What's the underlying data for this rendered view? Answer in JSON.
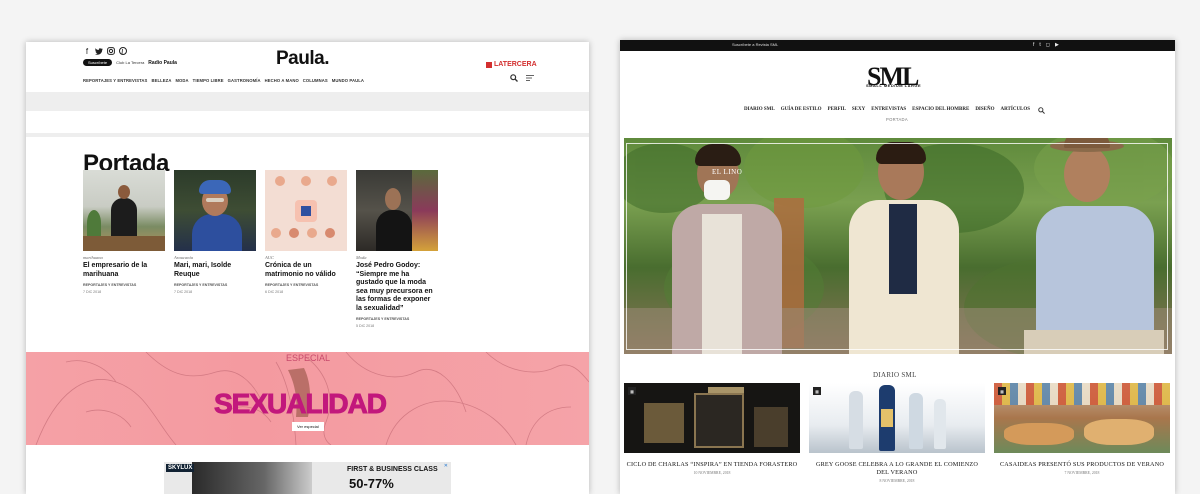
{
  "paula": {
    "logo": "Paula.",
    "tercera": "LATERCERA",
    "social_icons": [
      "facebook-icon",
      "twitter-icon",
      "instagram-icon",
      "pinterest-icon"
    ],
    "radio": {
      "pill": "Suscríbete",
      "club": "Club La Tercera",
      "radio_label": "Radio Paula"
    },
    "nav": [
      "REPORTAJES Y ENTREVISTAS",
      "BELLEZA",
      "MODA",
      "TIEMPO LIBRE",
      "GASTRONOMÍA",
      "HECHO A MANO",
      "COLUMNAS",
      "MUNDO PAULA"
    ],
    "section_title": "Portada",
    "cards": [
      {
        "category": "marihuana",
        "headline": "El empresario de la marihuana",
        "meta": "REPORTAJES Y ENTREVISTAS",
        "date": "7 DIC 2018"
      },
      {
        "category": "Araucanía",
        "headline": "Mari, mari, Isolde Reuque",
        "meta": "REPORTAJES Y ENTREVISTAS",
        "date": "7 DIC 2018"
      },
      {
        "category": "AUC",
        "headline": "Crónica de un matrimonio no válido",
        "meta": "REPORTAJES Y ENTREVISTAS",
        "date": "6 DIC 2018"
      },
      {
        "category": "Moda",
        "headline": "José Pedro Godoy: “Siempre me ha gustado que la moda sea muy precursora en las formas de exponer la sexualidad”",
        "meta": "REPORTAJES Y ENTREVISTAS",
        "date": "5 DIC 2018"
      }
    ],
    "banner": {
      "kicker": "ESPECIAL",
      "title": "SEXUALIDAD",
      "button": "Ver especial"
    },
    "ad": {
      "brand": "SKYLUX",
      "headline": "FIRST & BUSINESS CLASS",
      "discount": "50-77%"
    }
  },
  "sml": {
    "topbar": "Suscríbete a Revista SML",
    "logo": "SML",
    "logo_sub": "SMALL MEDIUM LARGE",
    "nav": [
      "DIARIO SML",
      "GUÍA DE ESTILO",
      "PERFIL",
      "SEXY",
      "ENTREVISTAS",
      "ESPACIO DEL HOMBRE",
      "DISEÑO",
      "ARTÍCULOS"
    ],
    "breadcrumb": "PORTADA",
    "hero_caption": "EL LINO",
    "section_title": "DIARIO SML",
    "cards": [
      {
        "headline": "CICLO DE CHARLAS “INSPIRA” EN TIENDA FORASTERO",
        "date": "10 NOVIEMBRE, 2018"
      },
      {
        "headline": "GREY GOOSE CELEBRA A LO GRANDE EL COMIENZO DEL VERANO",
        "date": "8 NOVIEMBRE, 2018"
      },
      {
        "headline": "CASAIDEAS PRESENTÓ SUS PRODUCTOS DE VERANO",
        "date": "7 NOVIEMBRE, 2018"
      }
    ]
  }
}
